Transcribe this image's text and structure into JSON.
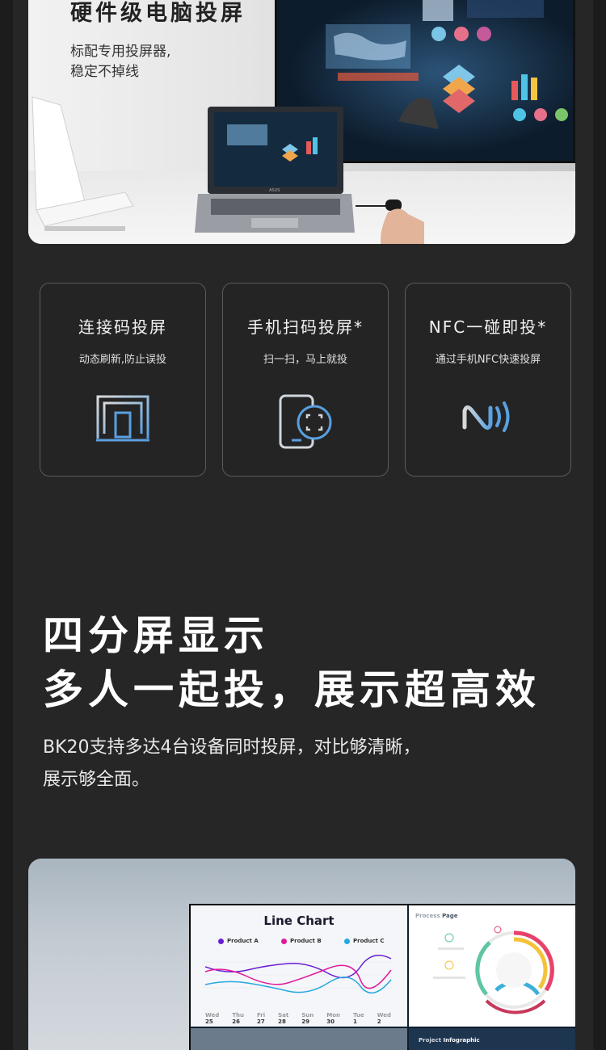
{
  "hero": {
    "title": "硬件级电脑投屏",
    "subtitle_lines": [
      "标配专用投屏器,",
      "稳定不掉线"
    ],
    "laptop_brand": "ASUS"
  },
  "features": [
    {
      "title": "连接码投屏",
      "subtitle": "动态刷新,防止误投",
      "icon": "screen-code-icon"
    },
    {
      "title": "手机扫码投屏*",
      "subtitle": "扫一扫，马上就投",
      "icon": "phone-scan-icon"
    },
    {
      "title": "NFC一碰即投*",
      "subtitle": "通过手机NFC快速投屏",
      "icon": "nfc-icon"
    }
  ],
  "section": {
    "heading_line1": "四分屏显示",
    "heading_line2": "多人一起投，展示超高效",
    "desc_line1": "BK20支持多达4台设备同时投屏，对比够清晰，",
    "desc_line2": "展示够全面。"
  },
  "quad_screen": {
    "line_chart_title": "Line Chart",
    "legend": [
      {
        "name": "Product A",
        "color": "#6a1fd0"
      },
      {
        "name": "Product B",
        "color": "#e0199a"
      },
      {
        "name": "Product C",
        "color": "#25a8e0"
      }
    ],
    "days": [
      {
        "label": "Wed",
        "num": "25"
      },
      {
        "label": "Thu",
        "num": "26"
      },
      {
        "label": "Fri",
        "num": "27"
      },
      {
        "label": "Sat",
        "num": "28"
      },
      {
        "label": "Sun",
        "num": "29"
      },
      {
        "label": "Mon",
        "num": "30"
      },
      {
        "label": "Tue",
        "num": "1"
      },
      {
        "label": "Wed",
        "num": "2"
      }
    ],
    "process_title_a": "Process",
    "process_title_b": "Page",
    "project_title_a": "Project",
    "project_title_b": "Infographic"
  },
  "colors": {
    "background": "#262626",
    "card_border": "#5b5b5b",
    "icon_blue": "#5aa0e0"
  }
}
